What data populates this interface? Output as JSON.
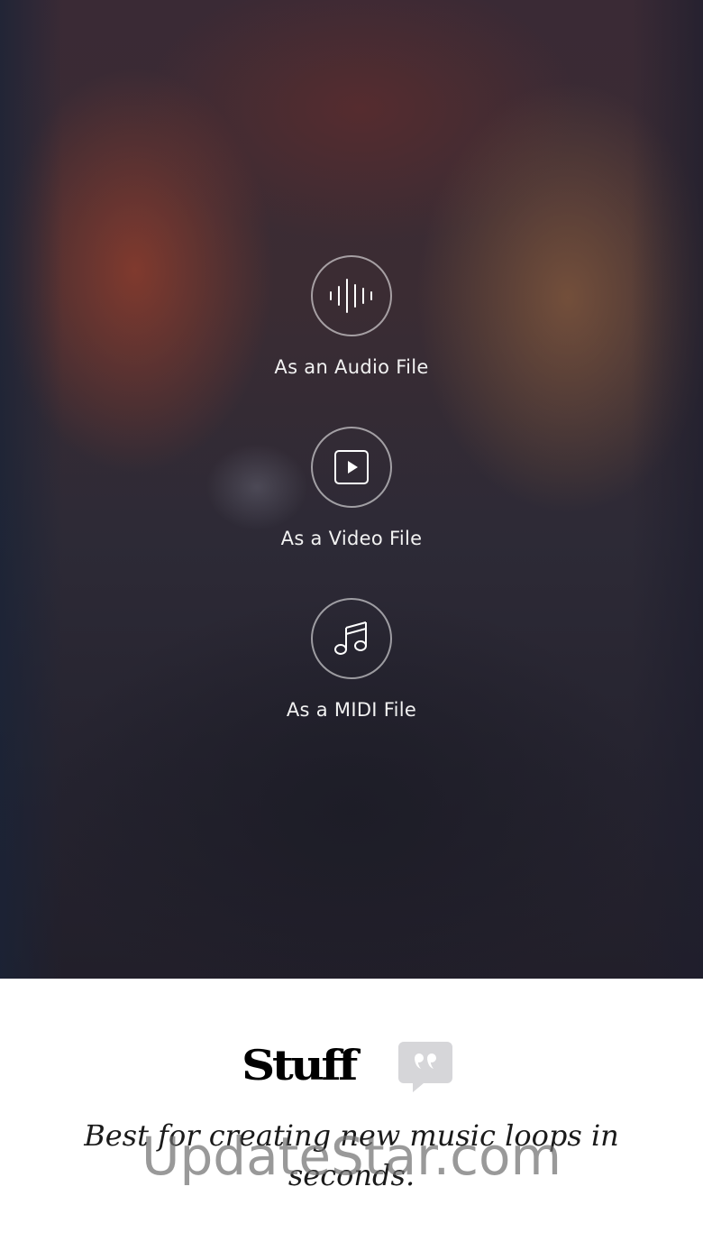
{
  "export_options": [
    {
      "label": "As an Audio File",
      "icon": "waveform-icon"
    },
    {
      "label": "As a Video File",
      "icon": "play-square-icon"
    },
    {
      "label": "As a MIDI File",
      "icon": "music-note-icon"
    }
  ],
  "review": {
    "publication": "Stuff",
    "quote_icon": "speech-quote-icon",
    "quote": "Best for creating new music loops in seconds."
  },
  "watermark": "UpdateStar.com",
  "colors": {
    "label_text": "#f2f2f2",
    "circle_border": "rgba(255,255,255,0.55)",
    "quote_bubble": "#d6d6d9",
    "review_bg": "#ffffff"
  }
}
